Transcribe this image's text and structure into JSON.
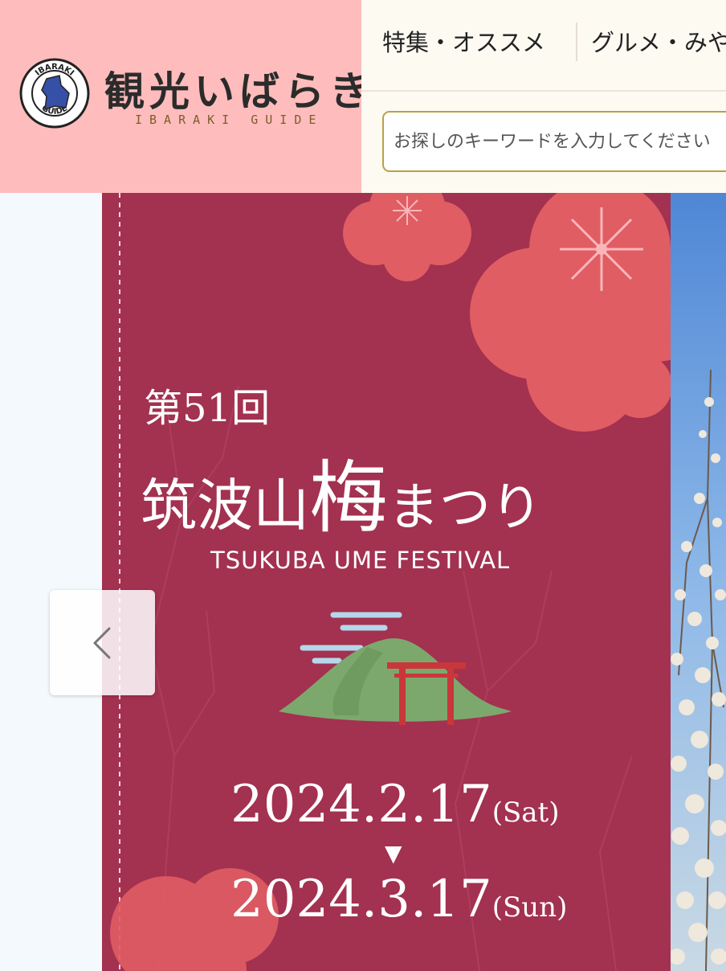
{
  "header": {
    "logo_title": "観光いばらき",
    "logo_subtitle": "IBARAKI GUIDE",
    "emblem_text_top": "IBARAKI",
    "emblem_text_bottom": "GUIDE"
  },
  "nav": {
    "items": [
      {
        "label": "特集・オススメ"
      },
      {
        "label": "グルメ・みや"
      }
    ]
  },
  "search": {
    "placeholder": "お探しのキーワードを入力してください"
  },
  "carousel": {
    "prev_icon": "chevron-left-icon",
    "banner": {
      "edition": "第51回",
      "title_main": "筑波山",
      "title_ume": "梅",
      "title_kana": "まつり",
      "subtitle": "TSUKUBA UME FESTIVAL",
      "start_date": "2024.2.17",
      "start_day": "(Sat)",
      "arrow": "▼",
      "end_date": "2024.3.17",
      "end_day": "(Sun)"
    }
  },
  "colors": {
    "header_pink": "#ffbcbc",
    "banner_crimson": "#a33150",
    "search_border": "#b6a249",
    "mountain_green": "#7da86d",
    "torii_red": "#c9373b"
  }
}
